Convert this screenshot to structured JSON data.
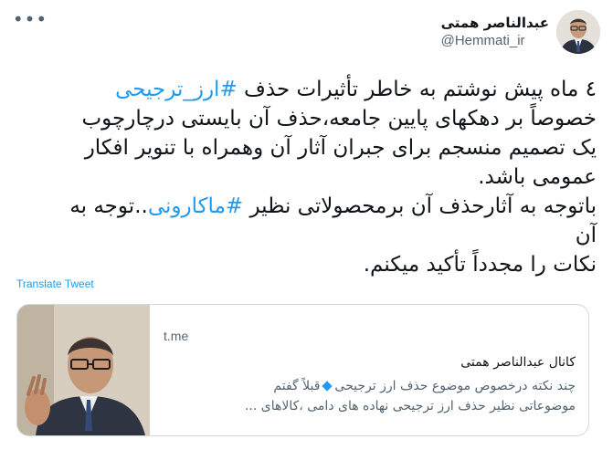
{
  "author": {
    "display_name": "عبدالناصر همتی",
    "handle": "@Hemmati_ir"
  },
  "more_icon": "more-horizontal-icon",
  "tweet": {
    "line1_prefix": "٤ ماه پیش نوشتم به خاطر تأثیرات حذف ",
    "line1_hashtag": "#ارز_ترجیحی",
    "line2": "خصوصاً بر دهکهای پایین جامعه،حذف آن بایستی درچارچوب",
    "line3": "یک تصمیم منسجم برای جبران آثار آن وهمراه با تنویر افکار",
    "line4": "عمومی باشد.",
    "line5_prefix": "باتوجه به آثارحذف آن برمحصولاتی نظیر ",
    "line5_hashtag": "#ماکارونی",
    "line5_suffix": "..توجه به",
    "line6": "آن",
    "line7": "نکات را مجدداً تأکید میکنم."
  },
  "translate_label": "Translate Tweet",
  "card": {
    "domain": "t.me",
    "title": "کانال عبدالناصر همتی",
    "desc_line1_a": "چند نکته درخصوص موضوع حذف ارز ترجیحی",
    "desc_line1_b": "قبلاً گفتم",
    "desc_line2": "موضوعاتی نظیر حذف ارز ترجیحی نهاده های دامی ،کالاهای ..."
  },
  "colors": {
    "link": "#1d9bf0",
    "text": "#0f1419",
    "muted": "#536471",
    "border": "#cfd9de"
  }
}
